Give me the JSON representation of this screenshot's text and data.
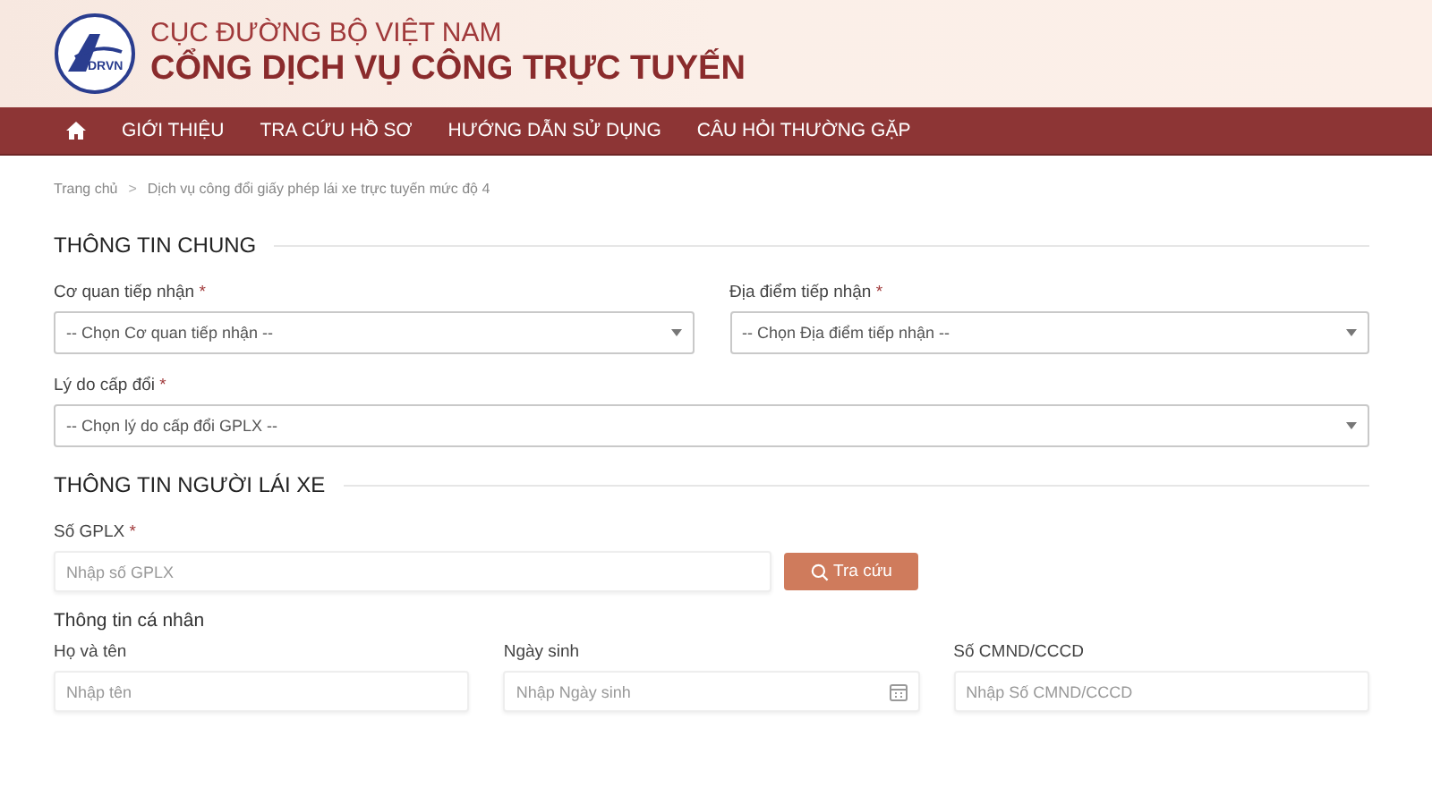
{
  "header": {
    "agency": "CỤC ĐƯỜNG BỘ VIỆT NAM",
    "portal": "CỔNG DỊCH VỤ CÔNG TRỰC TUYẾN",
    "logo_text": "DRVN"
  },
  "nav": {
    "items": [
      "GIỚI THIỆU",
      "TRA CỨU HỒ SƠ",
      "HƯỚNG DẪN SỬ DỤNG",
      "CÂU HỎI THƯỜNG GẶP"
    ]
  },
  "breadcrumb": [
    "Trang chủ",
    ">",
    "Dịch vụ công đổi giấy phép lái xe trực tuyến mức độ 4"
  ],
  "sections": [
    {
      "title": "THÔNG TIN CHUNG",
      "rows": [
        {
          "fields": [
            {
              "kind": "select",
              "label": "Cơ quan tiếp nhận",
              "required_mark": "*",
              "placeholder": "-- Chọn Cơ quan tiếp nhận --"
            },
            {
              "kind": "select",
              "label": "Địa điểm tiếp nhận",
              "required_mark": "*",
              "placeholder": "-- Chọn Địa điểm tiếp nhận --"
            }
          ]
        },
        {
          "fields": [
            {
              "kind": "select",
              "label": "Lý do cấp đổi",
              "required_mark": "*",
              "placeholder": "-- Chọn lý do cấp đổi GPLX --"
            }
          ]
        }
      ]
    },
    {
      "title": "THÔNG TIN NGƯỜI LÁI XE",
      "rows": [
        {
          "fields": [
            {
              "kind": "lookup",
              "label": "Số GPLX",
              "required_mark": "*",
              "placeholder": "Nhập số GPLX",
              "button": "Tra cứu"
            }
          ]
        },
        {
          "subtitle": "Thông tin cá nhân",
          "fields": [
            {
              "kind": "text",
              "label": "Họ và tên",
              "placeholder": "Nhập tên"
            },
            {
              "kind": "date",
              "label": "Ngày sinh",
              "placeholder": "Nhập Ngày sinh"
            },
            {
              "kind": "text",
              "label": "Số CMND/CCCD",
              "placeholder": "Nhập Số CMND/CCCD"
            }
          ]
        }
      ]
    }
  ]
}
